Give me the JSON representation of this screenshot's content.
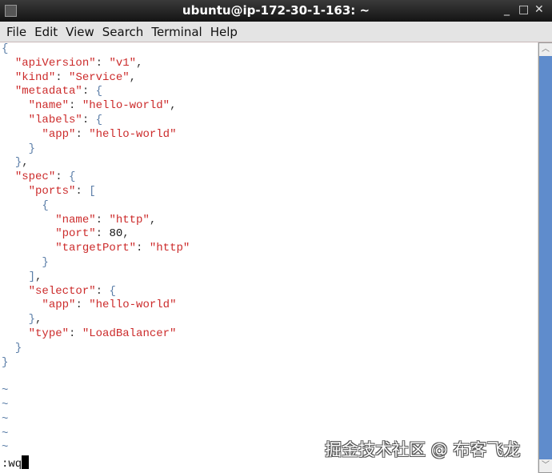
{
  "window": {
    "title": "ubuntu@ip-172-30-1-163: ~",
    "minimize": "_",
    "maximize": "□",
    "close": "✕"
  },
  "menu": [
    "File",
    "Edit",
    "View",
    "Search",
    "Terminal",
    "Help"
  ],
  "editor": {
    "lines": [
      [
        [
          "b",
          "{"
        ]
      ],
      [
        [
          "p",
          "  "
        ],
        [
          "k",
          "\"apiVersion\""
        ],
        [
          "p",
          ": "
        ],
        [
          "s",
          "\"v1\""
        ],
        [
          "p",
          ","
        ]
      ],
      [
        [
          "p",
          "  "
        ],
        [
          "k",
          "\"kind\""
        ],
        [
          "p",
          ": "
        ],
        [
          "s",
          "\"Service\""
        ],
        [
          "p",
          ","
        ]
      ],
      [
        [
          "p",
          "  "
        ],
        [
          "k",
          "\"metadata\""
        ],
        [
          "p",
          ": "
        ],
        [
          "b",
          "{"
        ]
      ],
      [
        [
          "p",
          "    "
        ],
        [
          "k",
          "\"name\""
        ],
        [
          "p",
          ": "
        ],
        [
          "s",
          "\"hello-world\""
        ],
        [
          "p",
          ","
        ]
      ],
      [
        [
          "p",
          "    "
        ],
        [
          "k",
          "\"labels\""
        ],
        [
          "p",
          ": "
        ],
        [
          "b",
          "{"
        ]
      ],
      [
        [
          "p",
          "      "
        ],
        [
          "k",
          "\"app\""
        ],
        [
          "p",
          ": "
        ],
        [
          "s",
          "\"hello-world\""
        ]
      ],
      [
        [
          "p",
          "    "
        ],
        [
          "b",
          "}"
        ]
      ],
      [
        [
          "p",
          "  "
        ],
        [
          "b",
          "}"
        ],
        [
          "p",
          ","
        ]
      ],
      [
        [
          "p",
          "  "
        ],
        [
          "k",
          "\"spec\""
        ],
        [
          "p",
          ": "
        ],
        [
          "b",
          "{"
        ]
      ],
      [
        [
          "p",
          "    "
        ],
        [
          "k",
          "\"ports\""
        ],
        [
          "p",
          ": "
        ],
        [
          "b",
          "["
        ]
      ],
      [
        [
          "p",
          "      "
        ],
        [
          "b",
          "{"
        ]
      ],
      [
        [
          "p",
          "        "
        ],
        [
          "k",
          "\"name\""
        ],
        [
          "p",
          ": "
        ],
        [
          "s",
          "\"http\""
        ],
        [
          "p",
          ","
        ]
      ],
      [
        [
          "p",
          "        "
        ],
        [
          "k",
          "\"port\""
        ],
        [
          "p",
          ": "
        ],
        [
          "n",
          "80"
        ],
        [
          "p",
          ","
        ]
      ],
      [
        [
          "p",
          "        "
        ],
        [
          "k",
          "\"targetPort\""
        ],
        [
          "p",
          ": "
        ],
        [
          "s",
          "\"http\""
        ]
      ],
      [
        [
          "p",
          "      "
        ],
        [
          "b",
          "}"
        ]
      ],
      [
        [
          "p",
          "    "
        ],
        [
          "b",
          "]"
        ],
        [
          "p",
          ","
        ]
      ],
      [
        [
          "p",
          "    "
        ],
        [
          "k",
          "\"selector\""
        ],
        [
          "p",
          ": "
        ],
        [
          "b",
          "{"
        ]
      ],
      [
        [
          "p",
          "      "
        ],
        [
          "k",
          "\"app\""
        ],
        [
          "p",
          ": "
        ],
        [
          "s",
          "\"hello-world\""
        ]
      ],
      [
        [
          "p",
          "    "
        ],
        [
          "b",
          "}"
        ],
        [
          "p",
          ","
        ]
      ],
      [
        [
          "p",
          "    "
        ],
        [
          "k",
          "\"type\""
        ],
        [
          "p",
          ": "
        ],
        [
          "s",
          "\"LoadBalancer\""
        ]
      ],
      [
        [
          "p",
          "  "
        ],
        [
          "b",
          "}"
        ]
      ],
      [
        [
          "b",
          "}"
        ]
      ],
      [
        [
          "p",
          ""
        ]
      ],
      [
        [
          "tilde",
          "~"
        ]
      ],
      [
        [
          "tilde",
          "~"
        ]
      ],
      [
        [
          "tilde",
          "~"
        ]
      ],
      [
        [
          "tilde",
          "~"
        ]
      ],
      [
        [
          "tilde",
          "~"
        ]
      ]
    ],
    "command": ":wq"
  },
  "watermark": "掘金技术社区 @ 布客飞龙"
}
